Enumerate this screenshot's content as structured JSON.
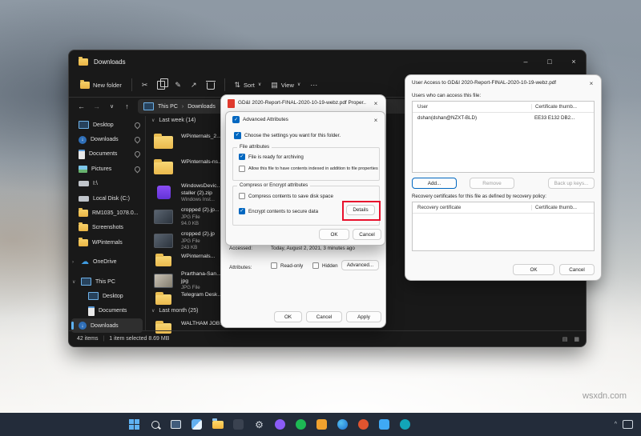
{
  "watermark": "wsxdn.com",
  "colors": {
    "accent": "#0067c0",
    "highlight_red": "#e8112d",
    "taskbar_bg": "#1c2534",
    "window_bg": "#191919",
    "dialog_bg": "#f9f9f9",
    "folder_yellow": "#f2c14b"
  },
  "glyphs": {
    "minimize": "–",
    "maximize": "□",
    "close": "×",
    "back": "←",
    "forward": "→",
    "up": "↑",
    "down": "↓",
    "chevron_down": "∨",
    "chevron_right": "›",
    "cut": "✂",
    "rename": "✎",
    "share": "↗",
    "more": "⋯",
    "sort": "⇅",
    "view_icon": "▤",
    "check": "✓",
    "cloud": "☁",
    "gear": "⚙",
    "list_icon": "▤",
    "grid_icon": "▦",
    "tray_chevron": "^"
  },
  "explorer": {
    "title": "Downloads",
    "toolbar": {
      "new_folder": "New folder",
      "sort": "Sort",
      "view": "View"
    },
    "breadcrumb": {
      "root": "This PC",
      "current": "Downloads"
    },
    "sidebar": [
      {
        "label": "Desktop"
      },
      {
        "label": "Downloads"
      },
      {
        "label": "Documents"
      },
      {
        "label": "Pictures"
      },
      {
        "label": "I:\\"
      },
      {
        "label": "Local Disk (C:)"
      },
      {
        "label": "RM1035_1078.0..."
      },
      {
        "label": "Screenshots"
      },
      {
        "label": "WPinternals"
      },
      {
        "label": "OneDrive"
      },
      {
        "label": "This PC"
      },
      {
        "label": "Desktop"
      },
      {
        "label": "Documents"
      },
      {
        "label": "Downloads"
      }
    ],
    "group1": "Last week (14)",
    "group2": "Last month (25)",
    "files": [
      {
        "l1": "WPinternals_2..."
      },
      {
        "l1": "WPinternals-ns..."
      },
      {
        "l1": "WindowsDevic...",
        "l2": "staller (2).zip",
        "l3": "Windows Inst..."
      },
      {
        "l1": "cropped (2).jp...",
        "l2": "JPG File",
        "l3": "94.0 KB"
      },
      {
        "l1": "cropped (2).jp",
        "l2": "JPG File",
        "l3": "243 KB"
      },
      {
        "l1": "WPinternals..."
      },
      {
        "l1": "Prarthana-San...",
        "l2": "jpg",
        "l3": "JPG File"
      },
      {
        "l1": "Telegram Desk..."
      },
      {
        "l1": "WALTHAM JOB..."
      }
    ],
    "status": {
      "items": "42 items",
      "selected": "1 item selected 8.69 MB"
    }
  },
  "properties_dialog": {
    "title": "GD&I 2020-Report-FINAL-2020-10-19-webz.pdf Proper...",
    "accessed_label": "Accessed:",
    "accessed_value": "Today, August 2, 2021, 3 minutes ago",
    "attributes_label": "Attributes:",
    "readonly": "Read-only",
    "hidden": "Hidden",
    "advanced": "Advanced...",
    "ok": "OK",
    "cancel": "Cancel",
    "apply": "Apply"
  },
  "advanced_dialog": {
    "title": "Advanced Attributes",
    "intro": "Choose the settings you want for this folder.",
    "file_attrs": "File attributes",
    "archive": "File is ready for archiving",
    "index": "Allow this file to have contents indexed in addition to file properties",
    "compress_attrs": "Compress or Encrypt attributes",
    "compress": "Compress contents to save disk space",
    "encrypt": "Encrypt contents to secure data",
    "details": "Details",
    "ok": "OK",
    "cancel": "Cancel"
  },
  "user_access_dialog": {
    "title": "User Access to GD&I 2020-Report-FINAL-2020-10-19-webz.pdf",
    "users_label": "Users who can access this file:",
    "col_user": "User",
    "col_cert": "Certificate thumb...",
    "row_user": "dshan(dshan@NZXT-BLD)",
    "row_cert": "EE33 E132 DB2...",
    "add": "Add...",
    "remove": "Remove",
    "backup": "Back up keys...",
    "recovery_label": "Recovery certificates for this file as defined by recovery policy:",
    "col_recovery": "Recovery certificate",
    "ok": "OK",
    "cancel": "Cancel"
  }
}
